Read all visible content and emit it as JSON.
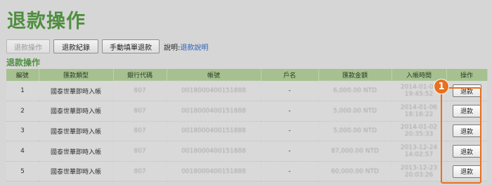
{
  "page": {
    "title": "退款操作"
  },
  "toolbar": {
    "refund_operation": "退款操作",
    "refund_records": "退款紀錄",
    "manual_refund": "手動填單退款",
    "help_label": "說明:",
    "help_link": "退款說明"
  },
  "section": {
    "title": "退款操作"
  },
  "table": {
    "headers": [
      "編號",
      "匯款類型",
      "銀行代碼",
      "帳號",
      "戶名",
      "匯款金額",
      "入帳時間",
      "操作"
    ],
    "rows": [
      {
        "no": "1",
        "type": "國泰世華即時入帳",
        "bank": "807",
        "account": "0018000400151888",
        "name": "-",
        "amount": "6,000.00 NTD",
        "time": "2014-01-07 19:45:52",
        "action": "退款"
      },
      {
        "no": "2",
        "type": "國泰世華即時入帳",
        "bank": "807",
        "account": "0018000400151888",
        "name": "-",
        "amount": "5,000.00 NTD",
        "time": "2014-01-06 18:16:22",
        "action": "退款"
      },
      {
        "no": "3",
        "type": "國泰世華即時入帳",
        "bank": "807",
        "account": "0018000400151888",
        "name": "-",
        "amount": "5,000.00 NTD",
        "time": "2014-01-02 20:35:33",
        "action": "退款"
      },
      {
        "no": "4",
        "type": "國泰世華即時入帳",
        "bank": "807",
        "account": "0018000400151888",
        "name": "-",
        "amount": "87,000.00 NTD",
        "time": "2013-12-24 14:02:57",
        "action": "退款"
      },
      {
        "no": "5",
        "type": "國泰世華即時入帳",
        "bank": "807",
        "account": "0018000400151888",
        "name": "-",
        "amount": "60,000.00 NTD",
        "time": "2013-12-23 20:03:26",
        "action": "退款"
      }
    ]
  },
  "annotation": {
    "step": "1",
    "color": "#e8701e"
  }
}
